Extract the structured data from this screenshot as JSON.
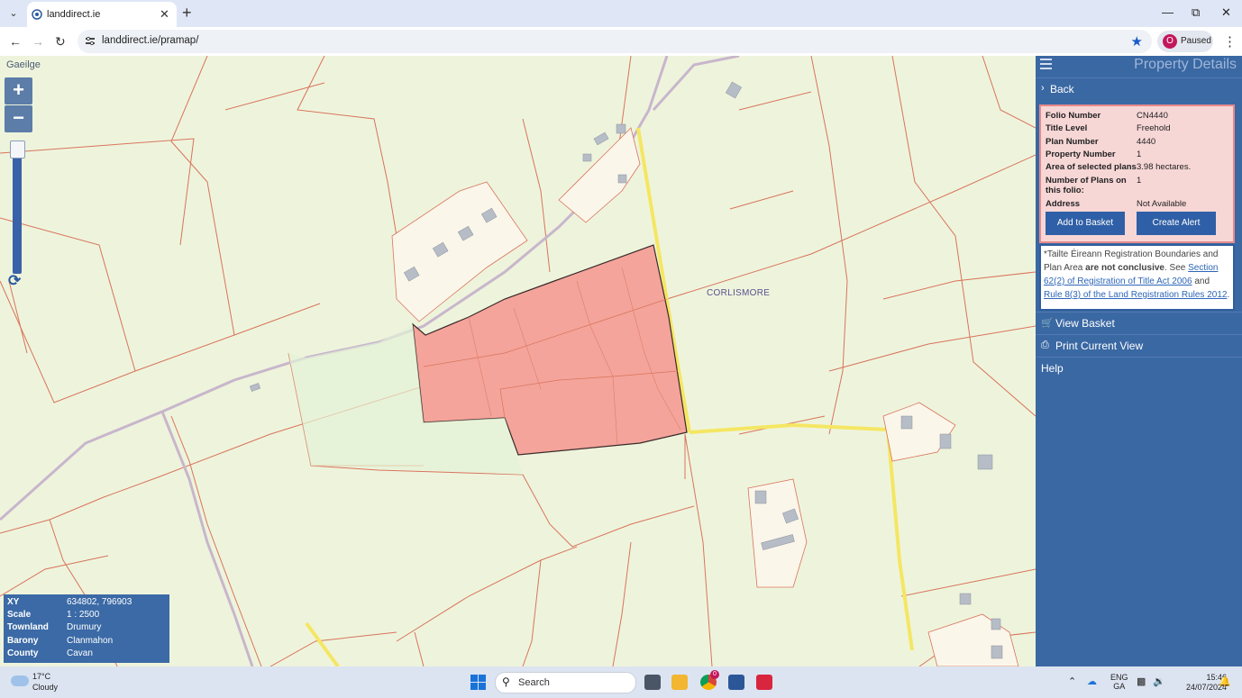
{
  "browser": {
    "tab_title": "landdirect.ie",
    "url": "landdirect.ie/pramap/",
    "profile_status": "Paused",
    "profile_initial": "O",
    "icons": {
      "tab_list": "chevron-down-icon",
      "close": "close-icon",
      "new_tab": "plus-icon",
      "back": "back-arrow-icon",
      "forward": "forward-arrow-icon",
      "reload": "reload-icon",
      "bookmark": "star-icon",
      "menu": "more-vert-icon"
    }
  },
  "map": {
    "language_link": "Gaeilge",
    "zoom_in": "+",
    "zoom_out": "−",
    "townland_label": "CORLISMORE",
    "selected_fill": "#f4a49a",
    "road_color": "#f5e663",
    "boundary_color": "#d9735c",
    "info": [
      {
        "key": "XY",
        "value": "634802, 796903"
      },
      {
        "key": "Scale",
        "value": "1 : 2500"
      },
      {
        "key": "Townland",
        "value": "Drumury"
      },
      {
        "key": "Barony",
        "value": "Clanmahon"
      },
      {
        "key": "County",
        "value": "Cavan"
      }
    ]
  },
  "panel": {
    "title": "Property Details",
    "back_label": "Back",
    "details": [
      {
        "key": "Folio Number",
        "value": "CN4440"
      },
      {
        "key": "Title Level",
        "value": "Freehold"
      },
      {
        "key": "Plan Number",
        "value": "4440"
      },
      {
        "key": "Property Number",
        "value": "1"
      },
      {
        "key": "Area of selected plans",
        "value": "3.98 hectares."
      },
      {
        "key": "Number of Plans on this folio:",
        "value": "1"
      },
      {
        "key": "Address",
        "value": "Not Available"
      }
    ],
    "add_to_basket": "Add to Basket",
    "create_alert": "Create Alert",
    "disclaimer": {
      "prefix": "*Tailte Éireann Registration Boundaries and Plan Area ",
      "bold": "are not conclusive",
      "mid": ". See ",
      "link1": "Section 62(2) of Registration of Title Act 2006",
      "and": " and ",
      "link2": "Rule 8(3) of the Land Registration Rules 2012",
      "end": "."
    },
    "view_basket": "View Basket",
    "print_view": "Print Current View",
    "help": "Help"
  },
  "taskbar": {
    "temperature": "17°C",
    "weather": "Cloudy",
    "search_placeholder": "Search",
    "chrome_badge": "0",
    "lang_top": "ENG",
    "lang_bottom": "GA",
    "time": "15:46",
    "date": "24/07/2024"
  }
}
